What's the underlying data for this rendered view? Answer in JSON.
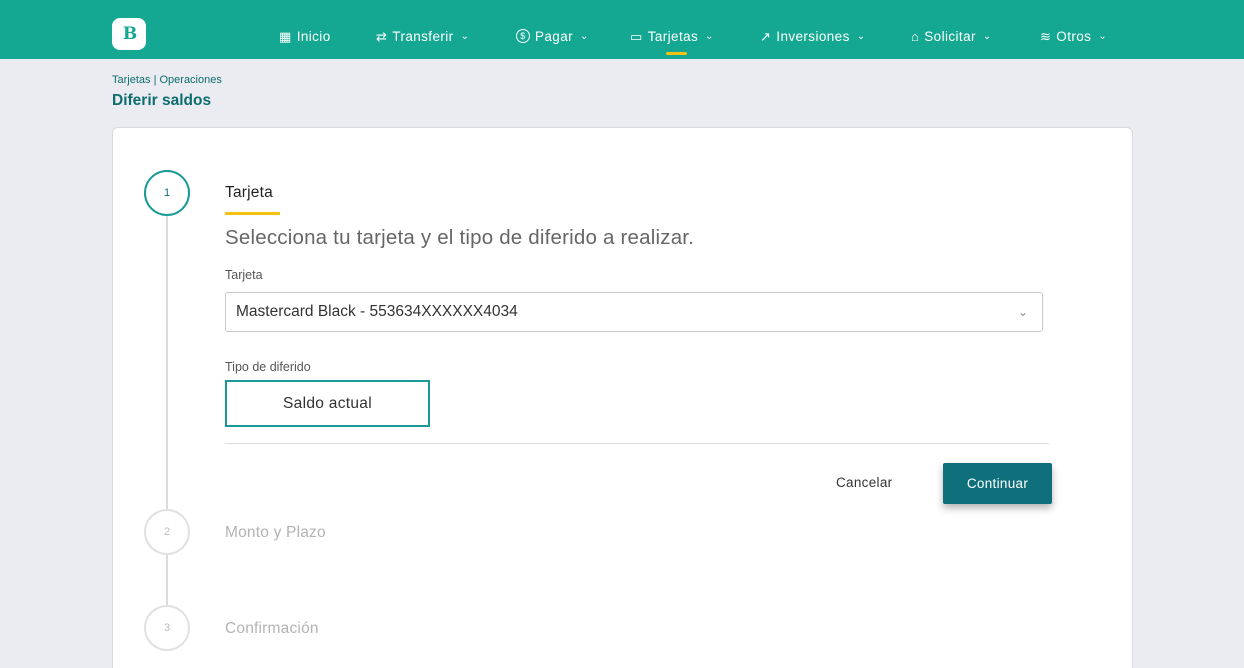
{
  "brand": {
    "logo_text": "B",
    "accent": "#14a893",
    "highlight": "#f5c20f"
  },
  "nav": {
    "items": [
      {
        "label": "Inicio",
        "icon": "grid-icon",
        "glyph": "▦",
        "has_menu": false
      },
      {
        "label": "Transferir",
        "icon": "transfer-arrows-icon",
        "glyph": "⇄",
        "has_menu": true
      },
      {
        "label": "Pagar",
        "icon": "dollar-circle-icon",
        "glyph": "$",
        "has_menu": true
      },
      {
        "label": "Tarjetas",
        "icon": "credit-card-icon",
        "glyph": "▭",
        "has_menu": true,
        "active": true
      },
      {
        "label": "Inversiones",
        "icon": "trending-up-icon",
        "glyph": "↗",
        "has_menu": true
      },
      {
        "label": "Solicitar",
        "icon": "bank-icon",
        "glyph": "⌂",
        "has_menu": true
      },
      {
        "label": "Otros",
        "icon": "stack-icon",
        "glyph": "≋",
        "has_menu": true
      }
    ],
    "chevron": "⌄"
  },
  "breadcrumb": "Tarjetas | Operaciones",
  "page_title": "Diferir saldos",
  "steps": [
    {
      "number": "1",
      "title": "Tarjeta",
      "state": "active"
    },
    {
      "number": "2",
      "title": "Monto y Plazo",
      "state": "pending"
    },
    {
      "number": "3",
      "title": "Confirmación",
      "state": "pending"
    }
  ],
  "form": {
    "subtitle": "Selecciona tu tarjeta y el tipo de diferido a realizar.",
    "card_label": "Tarjeta",
    "card_value": "Mastercard Black - 553634XXXXXX4034",
    "tipo_label": "Tipo de diferido",
    "tipo_option": "Saldo actual",
    "cancel_label": "Cancelar",
    "continue_label": "Continuar"
  }
}
